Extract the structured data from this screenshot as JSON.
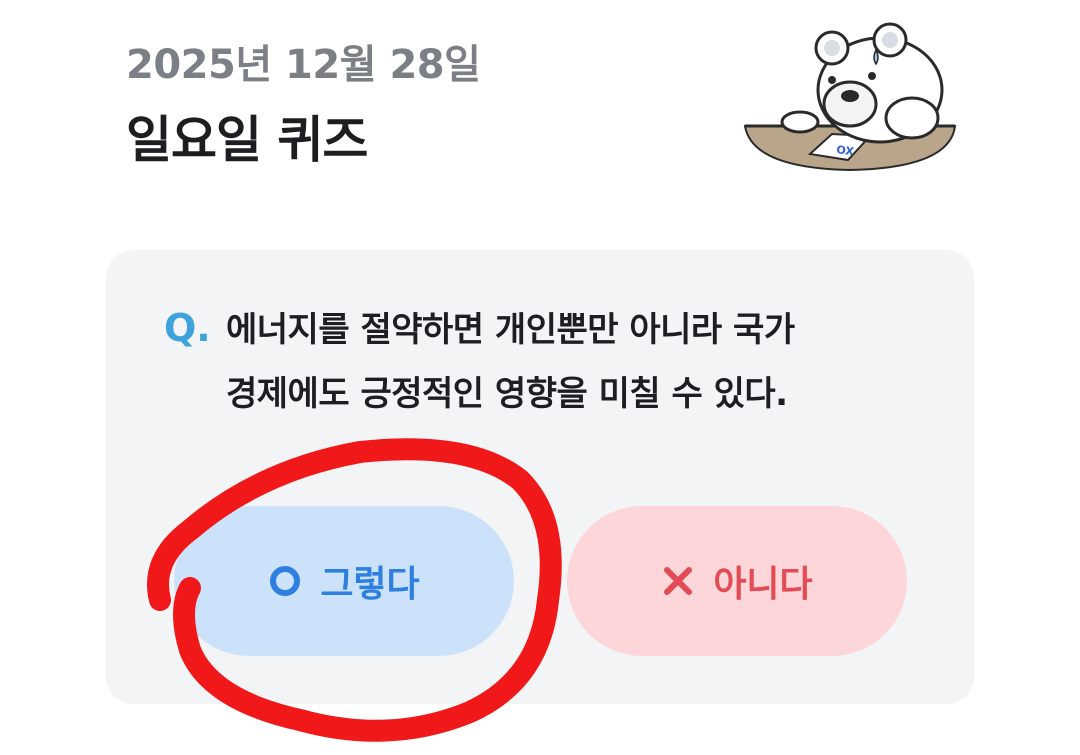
{
  "header": {
    "date": "2025년 12월 28일",
    "title": "일요일 퀴즈"
  },
  "mascot": {
    "icon": "bear-mascot-icon",
    "sheet_label": "OX"
  },
  "quiz": {
    "q_mark": "Q.",
    "question_line1": "에너지를 절약하면 개인뿐만 아니라 국가",
    "question_line2": "경제에도 긍정적인 영향을 미칠 수 있다.",
    "answers": [
      {
        "label": "그렇다",
        "icon": "circle-o-icon",
        "color": "#2d7fe0",
        "bg": "#cce2fb"
      },
      {
        "label": "아니다",
        "icon": "x-mark-icon",
        "color": "#e34b55",
        "bg": "#fcd6d9"
      }
    ]
  },
  "colors": {
    "accent_blue": "#3ea3dd",
    "annotation_red": "#f01818",
    "card_bg": "#f3f4f6"
  }
}
